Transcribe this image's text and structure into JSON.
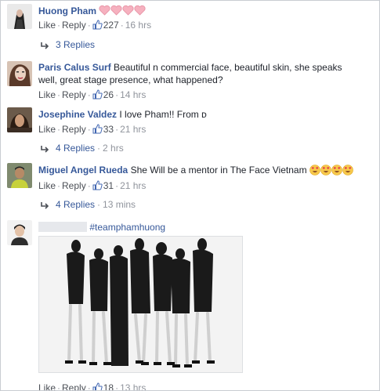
{
  "comments": [
    {
      "author": "Huong Pham",
      "text": "",
      "hearts": 4,
      "actions": {
        "like": "Like",
        "reply": "Reply"
      },
      "likes": "227",
      "time": "16 hrs",
      "replies": "3 Replies"
    },
    {
      "author": "Paris Calus Surf",
      "text_line1": "Beautiful n commercial face, beautiful skin, she speaks",
      "text_line2": "well, great stage presence, what happened?",
      "actions": {
        "like": "Like",
        "reply": "Reply"
      },
      "likes": "26",
      "time": "14 hrs"
    },
    {
      "author": "Josephine Valdez",
      "text": "I love Pham!! From ᴅ",
      "actions": {
        "like": "Like",
        "reply": "Reply"
      },
      "likes": "33",
      "time": "21 hrs",
      "replies": "4 Replies",
      "replies_time": "2 hrs"
    },
    {
      "author": "Miguel Angel Rueda",
      "text": "She Will be a mentor in The Face Vietnam",
      "emoji_count": 4,
      "actions": {
        "like": "Like",
        "reply": "Reply"
      },
      "likes": "31",
      "time": "21 hrs",
      "replies": "4 Replies",
      "replies_time": "13 mins"
    },
    {
      "author": "",
      "text": "#teamphamhuong",
      "image": "group-photo-seven-women-black-outfits",
      "actions": {
        "like": "Like",
        "reply": "Reply"
      },
      "likes": "18",
      "time": "13 hrs"
    }
  ],
  "separator": "·",
  "colors": {
    "name": "#365899",
    "text": "#1d2129",
    "meta": "#4b4f56",
    "time": "#90949c",
    "heart": "#f4a6b4",
    "like_icon": "#4267b2"
  }
}
